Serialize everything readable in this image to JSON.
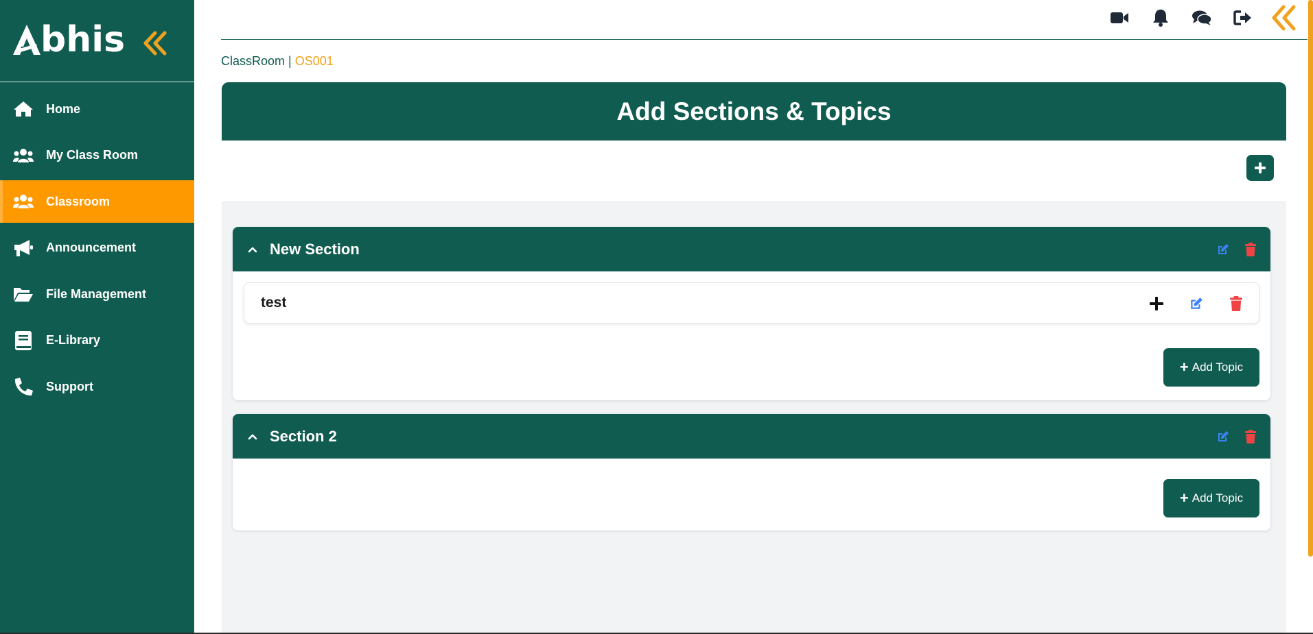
{
  "app": {
    "logo_text": "bhis",
    "logo_full": "Abhis"
  },
  "sidebar": {
    "items": [
      {
        "label": "Home",
        "icon": "home-icon",
        "active": false
      },
      {
        "label": "My Class Room",
        "icon": "users-icon",
        "active": false
      },
      {
        "label": "Classroom",
        "icon": "users-icon",
        "active": true
      },
      {
        "label": "Announcement",
        "icon": "megaphone-icon",
        "active": false
      },
      {
        "label": "File Management",
        "icon": "folder-open-icon",
        "active": false
      },
      {
        "label": "E-Library",
        "icon": "book-icon",
        "active": false
      },
      {
        "label": "Support",
        "icon": "phone-icon",
        "active": false
      }
    ]
  },
  "topbar": {
    "icons": [
      "video-icon",
      "bell-icon",
      "chat-icon",
      "logout-icon",
      "double-chevron-left-icon"
    ]
  },
  "breadcrumb": {
    "root": "ClassRoom",
    "separator": " | ",
    "code": "OS001"
  },
  "main": {
    "title": "Add Sections & Topics",
    "sections": [
      {
        "title": "New Section",
        "topics": [
          {
            "title": "test"
          }
        ],
        "add_topic_label": "Add Topic"
      },
      {
        "title": "Section 2",
        "topics": [],
        "add_topic_label": "Add Topic"
      }
    ]
  },
  "colors": {
    "primary": "#115c50",
    "accent": "#ff9900",
    "edit": "#3b82f6",
    "delete": "#ef4444"
  }
}
